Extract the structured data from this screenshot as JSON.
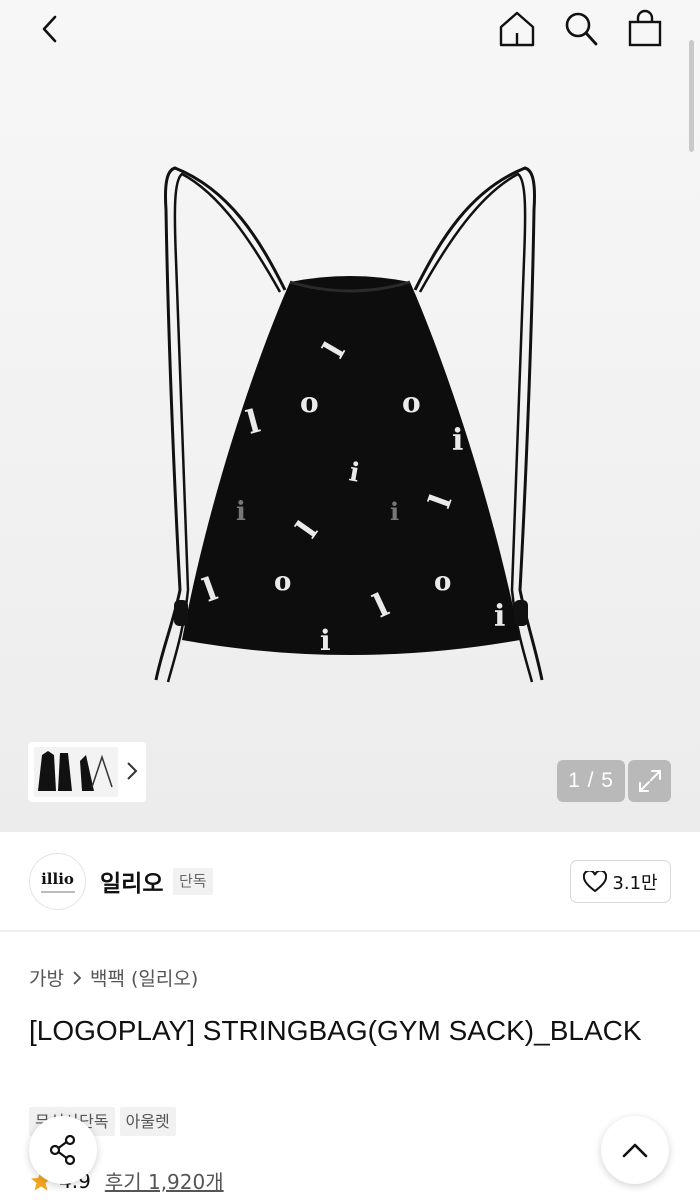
{
  "header": {
    "icons": [
      "back-icon",
      "home-icon",
      "search-icon",
      "shopping-bag-icon"
    ]
  },
  "gallery": {
    "counter": "1 / 5",
    "thumbnail_count": 3
  },
  "brand": {
    "logo_text": "illio",
    "name": "일리오",
    "badge": "단독",
    "likes": "3.1만"
  },
  "breadcrumb": {
    "category": "가방",
    "subcategory": "백팩 (일리오)"
  },
  "product": {
    "title": "[LOGOPLAY] STRINGBAG(GYM SACK)_BLACK"
  },
  "tags": [
    "무신사단독",
    "아울렛"
  ],
  "rating": {
    "score": "4.9",
    "reviews": "후기 1,920개"
  },
  "colors": {
    "star": "#f5a623",
    "badge_bg": "#f1f1f1",
    "counter_bg": "#b9b9b9"
  }
}
